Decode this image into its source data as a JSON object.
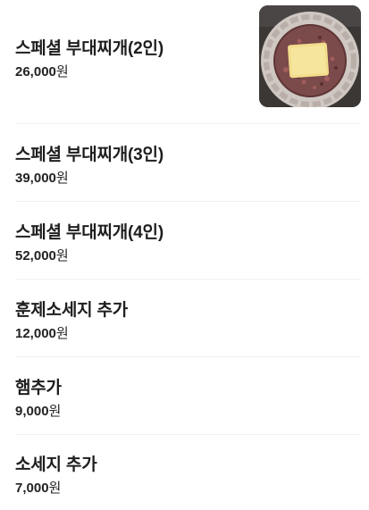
{
  "menu": {
    "items": [
      {
        "name": "스페셜 부대찌개(2인)",
        "price": "26,000",
        "currency": "원",
        "image": "budae-jjigae-photo"
      },
      {
        "name": "스페셜 부대찌개(3인)",
        "price": "39,000",
        "currency": "원"
      },
      {
        "name": "스페셜 부대찌개(4인)",
        "price": "52,000",
        "currency": "원"
      },
      {
        "name": "훈제소세지 추가",
        "price": "12,000",
        "currency": "원"
      },
      {
        "name": "햄추가",
        "price": "9,000",
        "currency": "원"
      },
      {
        "name": "소세지 추가",
        "price": "7,000",
        "currency": "원"
      }
    ]
  }
}
